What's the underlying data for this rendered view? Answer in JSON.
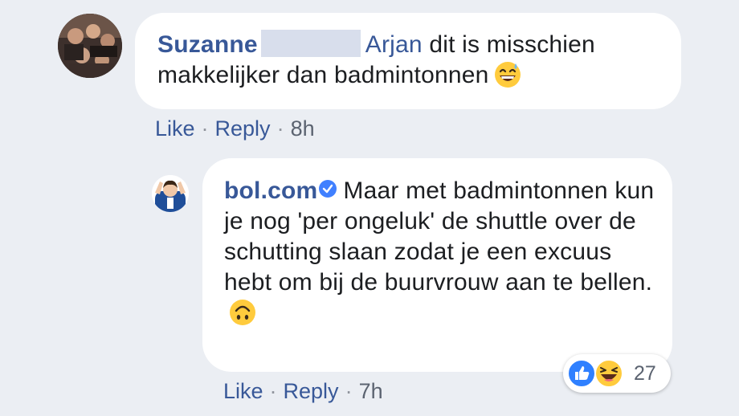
{
  "comments": [
    {
      "author": "Suzanne",
      "mention": "Arjan",
      "text_line1": " dit is misschien",
      "text_line2": "makkelijker dan badmintonnen",
      "emoji": "grinning-sweat-emoji",
      "like_label": "Like",
      "reply_label": "Reply",
      "separator": "·",
      "time": "8h"
    },
    {
      "author": "bol.com",
      "verified": true,
      "text": "Maar met badmintonnen kun je nog 'per ongeluk' de shuttle over de schutting slaan zodat je een excuus hebt om bij de buurvrouw aan te bellen.",
      "emoji": "upside-down-face-emoji",
      "like_label": "Like",
      "reply_label": "Reply",
      "separator": "·",
      "time": "7h",
      "reactions": {
        "types": [
          "like-reaction-icon",
          "haha-reaction-icon"
        ],
        "count": "27"
      }
    }
  ],
  "colors": {
    "link": "#385898",
    "background": "#ebeef3",
    "bubble": "#ffffff",
    "verified": "#4080ff",
    "meta": "#90949c"
  }
}
